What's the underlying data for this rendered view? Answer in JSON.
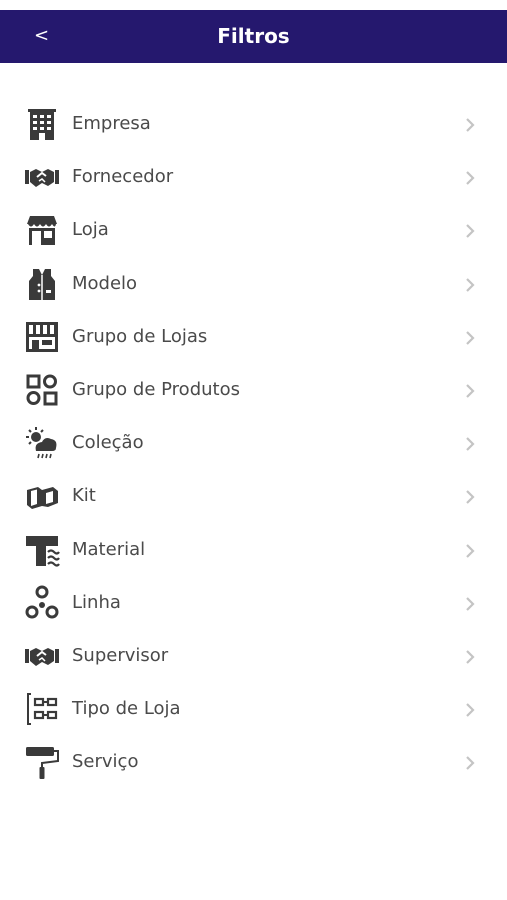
{
  "header": {
    "title": "Filtros",
    "back_label": "<"
  },
  "items": [
    {
      "label": "Empresa",
      "icon": "building-icon"
    },
    {
      "label": "Fornecedor",
      "icon": "handshake-icon"
    },
    {
      "label": "Loja",
      "icon": "store-icon"
    },
    {
      "label": "Modelo",
      "icon": "vest-icon"
    },
    {
      "label": "Grupo de Lojas",
      "icon": "store-group-icon"
    },
    {
      "label": "Grupo de Produtos",
      "icon": "shapes-grid-icon"
    },
    {
      "label": "Coleção",
      "icon": "weather-icon"
    },
    {
      "label": "Kit",
      "icon": "box-open-icon"
    },
    {
      "label": "Material",
      "icon": "fabric-icon"
    },
    {
      "label": "Linha",
      "icon": "molecule-icon"
    },
    {
      "label": "Supervisor",
      "icon": "handshake-icon"
    },
    {
      "label": "Tipo de Loja",
      "icon": "hierarchy-icon"
    },
    {
      "label": "Serviço",
      "icon": "paint-roller-icon"
    }
  ],
  "colors": {
    "header_bg": "#25186e",
    "header_text": "#ffffff",
    "label": "#4a4a4a",
    "icon": "#3a3a3a",
    "chevron": "#c4c4c4"
  }
}
